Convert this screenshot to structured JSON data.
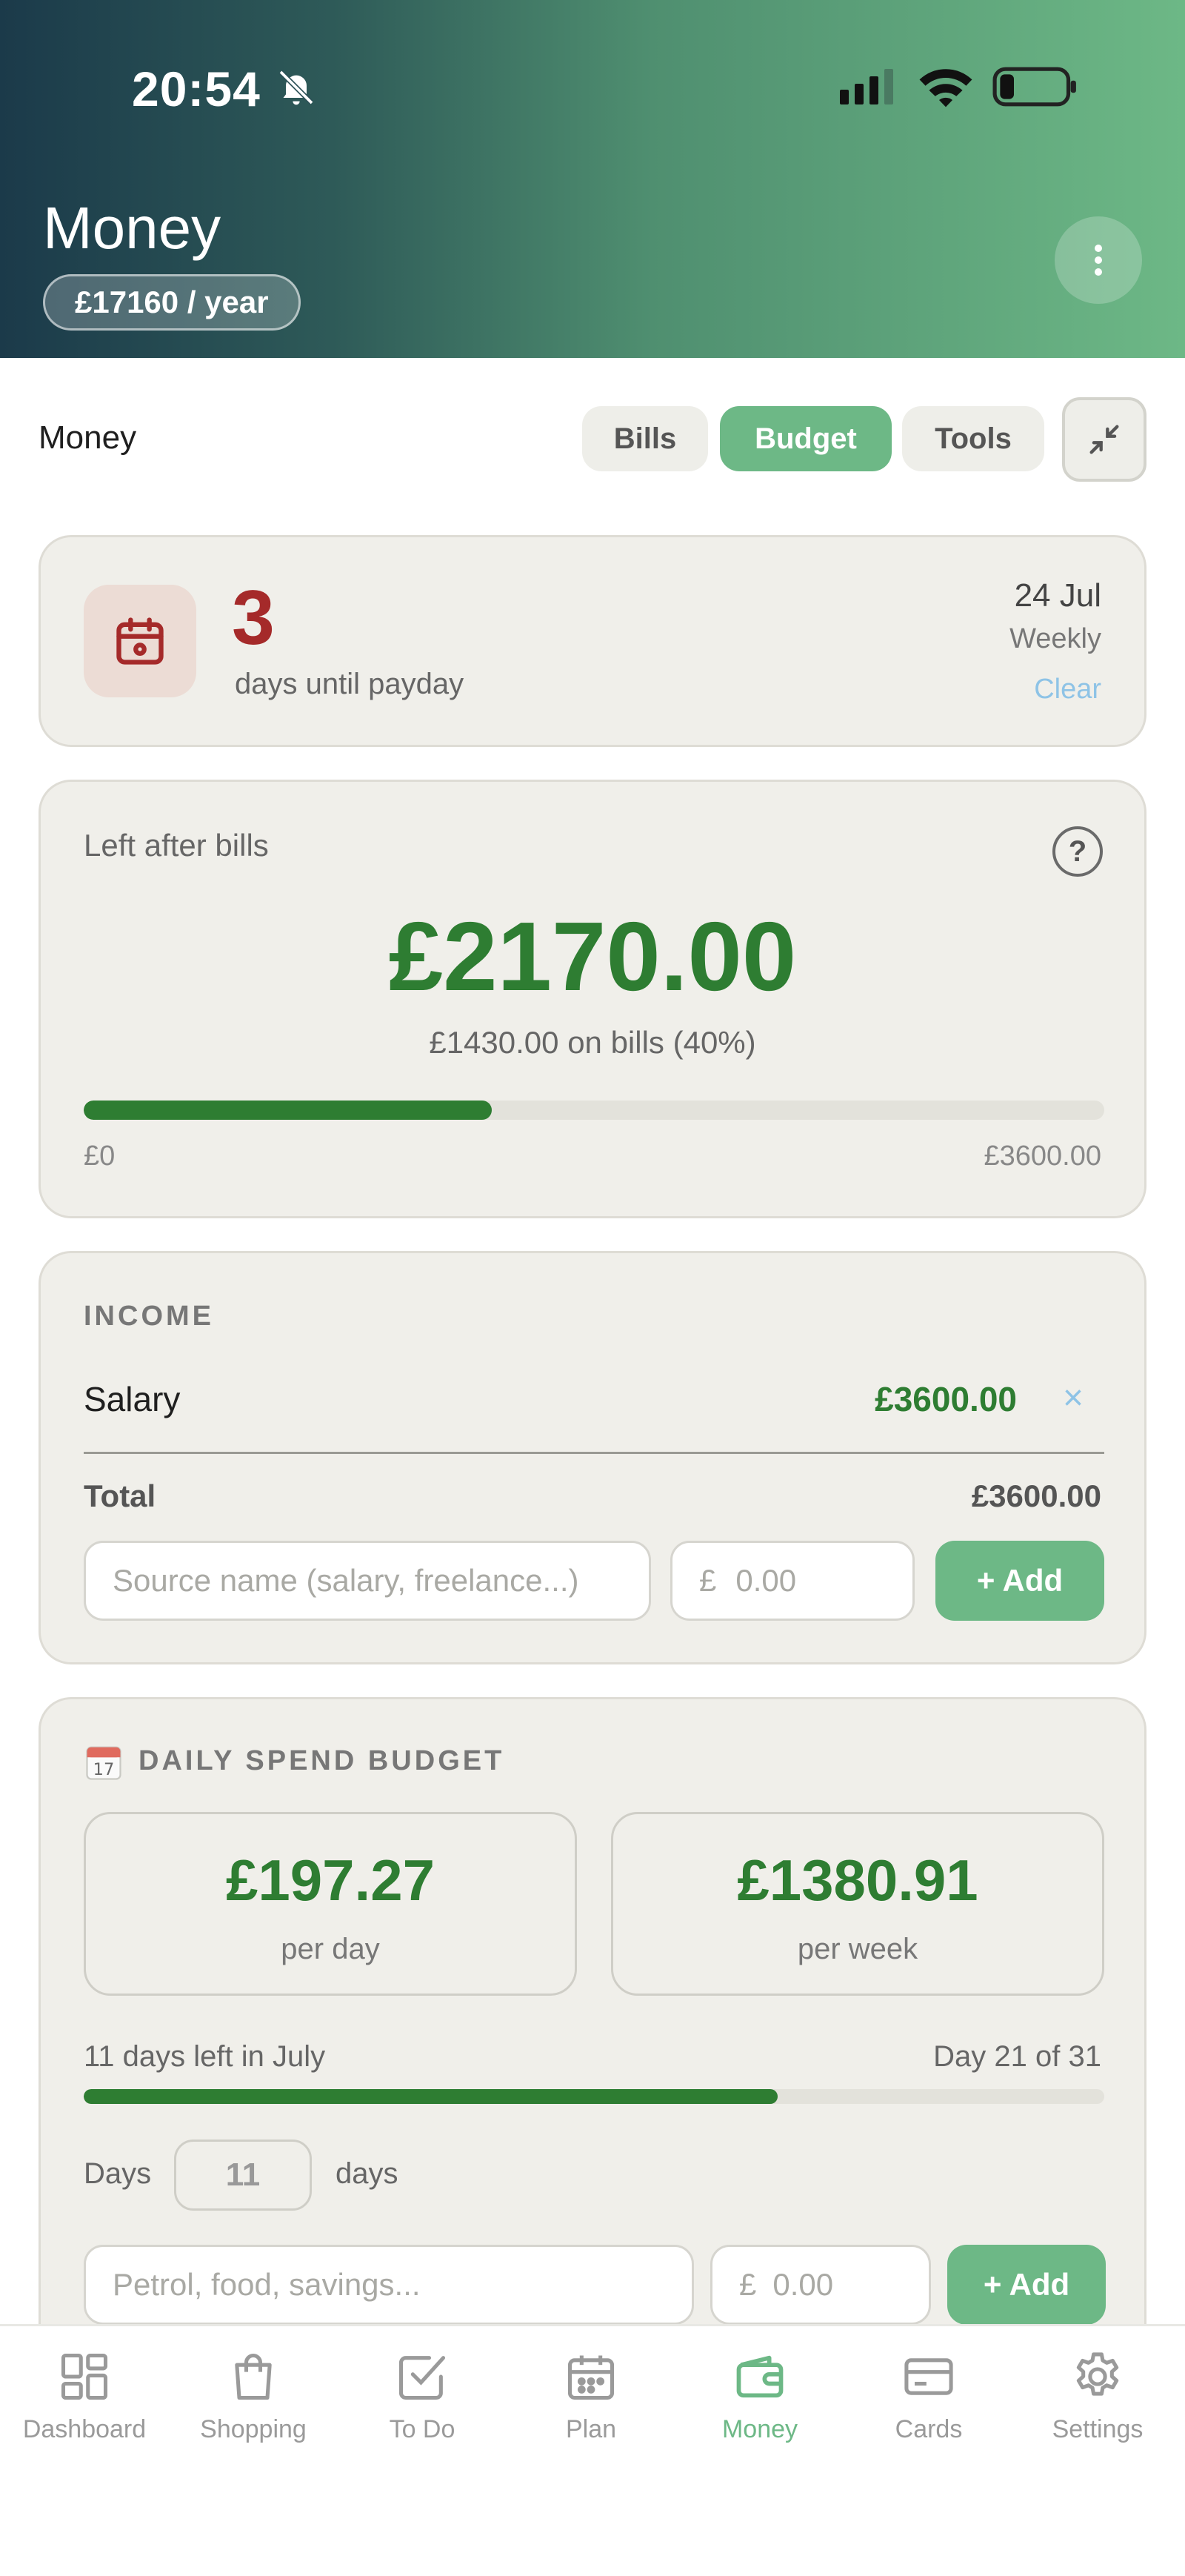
{
  "status_bar": {
    "time": "20:54"
  },
  "header": {
    "title": "Money",
    "yearly_pill": "£17160 / year"
  },
  "section": {
    "label": "Money",
    "segments": {
      "bills": "Bills",
      "budget": "Budget",
      "tools": "Tools"
    },
    "active_segment": "Budget"
  },
  "payday": {
    "count": "3",
    "subtitle": "days until payday",
    "date": "24 Jul",
    "frequency": "Weekly",
    "clear_label": "Clear"
  },
  "left_after_bills": {
    "label": "Left after bills",
    "help": "?",
    "amount": "£2170.00",
    "bills_summary": "£1430.00 on bills (40%)",
    "progress": 0.4,
    "scale_min": "£0",
    "scale_max": "£3600.00"
  },
  "income": {
    "heading": "INCOME",
    "items": [
      {
        "name": "Salary",
        "amount": "£3600.00",
        "remove": "×"
      }
    ],
    "total_label": "Total",
    "total_amount": "£3600.00",
    "name_placeholder": "Source name (salary, freelance...)",
    "currency": "£",
    "amount_placeholder": "0.00",
    "add_label": "+ Add"
  },
  "daily_spend": {
    "heading": "DAILY SPEND BUDGET",
    "per_day_amount": "£197.27",
    "per_day_label": "per day",
    "per_week_amount": "£1380.91",
    "per_week_label": "per week",
    "days_left_text": "11 days left in July",
    "day_of_text": "Day 21 of 31",
    "month_progress": 0.68,
    "days_label": "Days",
    "days_value": "11",
    "days_unit": "days",
    "name_placeholder": "Petrol, food, savings...",
    "currency": "£",
    "amount_placeholder": "0.00",
    "add_label": "+ Add"
  },
  "nav": {
    "items": [
      {
        "label": "Dashboard",
        "icon": "dashboard-icon"
      },
      {
        "label": "Shopping",
        "icon": "shopping-bag-icon"
      },
      {
        "label": "To Do",
        "icon": "checkbox-icon"
      },
      {
        "label": "Plan",
        "icon": "calendar-icon"
      },
      {
        "label": "Money",
        "icon": "wallet-icon"
      },
      {
        "label": "Cards",
        "icon": "card-icon"
      },
      {
        "label": "Settings",
        "icon": "gear-icon"
      }
    ],
    "active": "Money"
  },
  "colors": {
    "accent": "#6db886",
    "money_green": "#2e7d32",
    "payday_red": "#a52a2a",
    "link_blue": "#8ec3e6"
  }
}
